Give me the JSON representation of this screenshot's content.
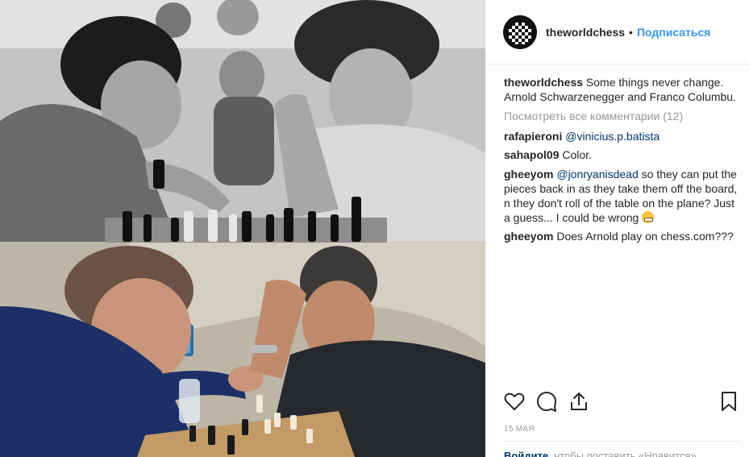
{
  "post": {
    "username": "theworldchess",
    "separator": "•",
    "follow_label": "Подписаться",
    "caption": "Some things never change. Arnold Schwarzenegger and Franco Columbu.",
    "view_all_comments": "Посмотреть все комментарии (12)",
    "comments": [
      {
        "user": "rafapieroni",
        "mention": "@vinicius.p.batista",
        "text": ""
      },
      {
        "user": "sahapol09",
        "mention": "",
        "text": "Color."
      },
      {
        "user": "gheeyom",
        "mention": "@jonryanisdead",
        "text": " so they can put the pieces back in as they take them off the board, n they don't roll of the table on the plane? Just a guess... I could be wrong"
      },
      {
        "user": "gheeyom",
        "mention": "",
        "text": "Does Arnold play on chess.com???"
      }
    ],
    "date": "15 мая",
    "login_prompt_link": "Войдите",
    "login_prompt_text": ", чтобы поставить «Нравится»"
  },
  "icons": {
    "avatar": "chess-board-logo",
    "like": "heart-icon",
    "comment": "comment-bubble-icon",
    "share": "share-icon",
    "save": "bookmark-icon"
  },
  "colors": {
    "link_blue": "#3897f0",
    "mention_blue": "#003569",
    "muted": "#999999",
    "text": "#262626"
  }
}
